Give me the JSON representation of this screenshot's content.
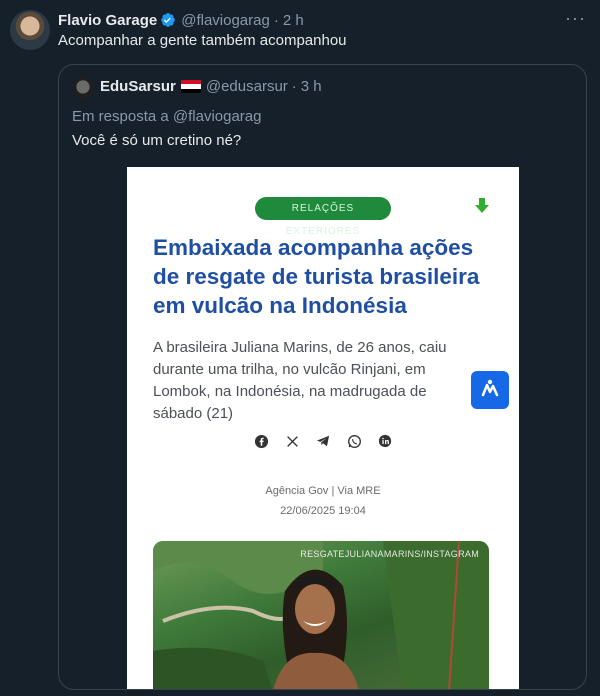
{
  "tweet": {
    "author_name": "Flavio Garage",
    "handle": "@flaviogarag",
    "separator": "·",
    "time": "2 h",
    "text": "Acompanhar a gente também acompanhou"
  },
  "quote": {
    "author_name": "EduSarsur",
    "handle": "@edusarsur",
    "separator": "·",
    "time": "3 h",
    "reply_to": "Em resposta a @flaviogarag",
    "text": "Você é só um cretino né?",
    "article": {
      "category": "RELAÇÕES EXTERIORES",
      "headline": "Embaixada acompanha ações de resgate de turista brasileira em vulcão na Indonésia",
      "lede": "A brasileira Juliana Marins, de 26 anos, caiu durante uma trilha, no vulcão Rinjani, em Lombok, na Indonésia, na madrugada de sábado (21)",
      "source": "Agência Gov | Via MRE",
      "date": "22/06/2025 19:04",
      "photo_credit": "RESGATEJULIANAMARINS/INSTAGRAM"
    }
  },
  "colors": {
    "background": "#15202b",
    "verified": "#1d9bf0",
    "pill": "#1f8a3b",
    "headline": "#1f4fa3"
  },
  "icons": [
    "verified-badge-icon",
    "more-icon",
    "download-icon",
    "accessibility-icon",
    "facebook-icon",
    "x-icon",
    "telegram-icon",
    "whatsapp-icon",
    "linkedin-icon"
  ]
}
